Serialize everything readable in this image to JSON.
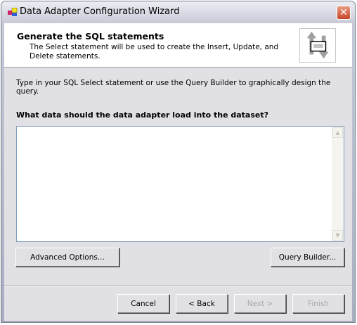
{
  "window": {
    "title": "Data Adapter Configuration Wizard",
    "close_label": "✕"
  },
  "header": {
    "title": "Generate the SQL statements",
    "subtitle": "The Select statement will be used to create the Insert, Update, and Delete statements."
  },
  "body": {
    "instruction": "Type in your SQL Select statement or use the Query Builder to graphically design the query.",
    "question": "What data should the data adapter load into the dataset?",
    "sql_value": "",
    "advanced_label": "Advanced Options...",
    "query_builder_label": "Query Builder..."
  },
  "footer": {
    "cancel": "Cancel",
    "back": "< Back",
    "next": "Next >",
    "finish": "Finish"
  }
}
